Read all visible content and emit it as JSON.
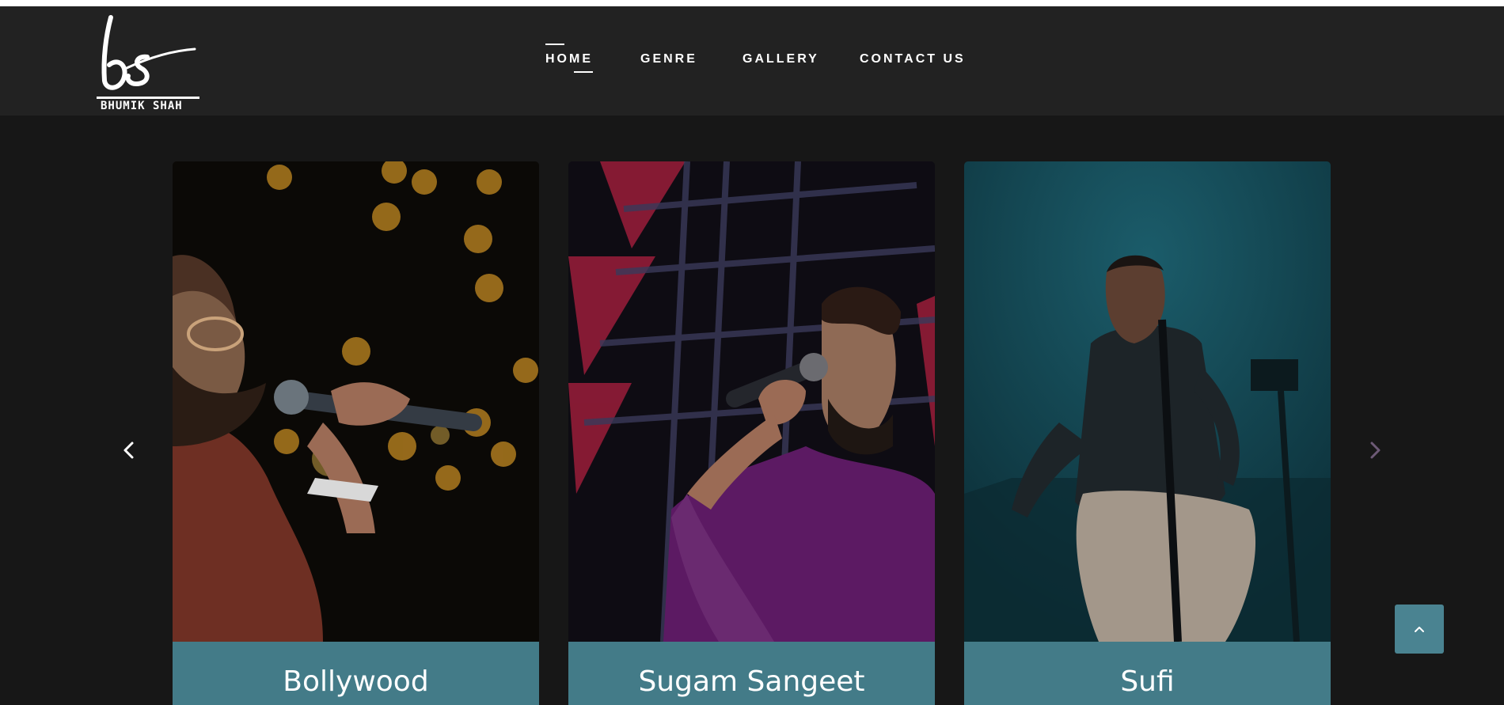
{
  "brand": {
    "monogram": "bs",
    "name": "BHUMIK SHAH"
  },
  "nav": {
    "items": [
      {
        "label": "HOME",
        "active": true
      },
      {
        "label": "GENRE",
        "active": false
      },
      {
        "label": "GALLERY",
        "active": false
      },
      {
        "label": "CONTACT US",
        "active": false
      }
    ]
  },
  "carousel": {
    "cards": [
      {
        "title": "Bollywood",
        "photo": "singer-with-microphone-bokeh-lights"
      },
      {
        "title": "Sugam Sangeet",
        "photo": "singer-in-purple-kurta-with-microphone"
      },
      {
        "title": "Sufi",
        "photo": "singer-seated-with-mic-stand-teal-stage"
      }
    ],
    "prev_icon": "chevron-left-icon",
    "next_icon": "chevron-right-icon"
  },
  "scroll_top": {
    "icon": "chevron-up-icon"
  },
  "colors": {
    "background": "#171717",
    "header": "#222222",
    "caption": "#437b88",
    "scroll_button": "#4a8391",
    "next_arrow": "#6d5a76"
  }
}
